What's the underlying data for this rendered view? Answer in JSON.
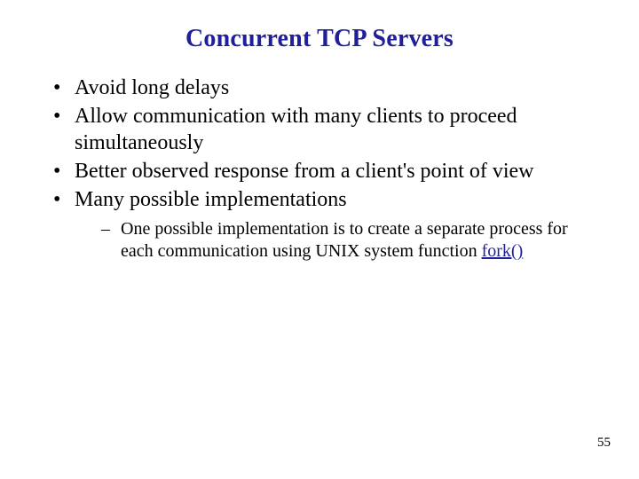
{
  "title": "Concurrent TCP Servers",
  "bullets": [
    "Avoid long delays",
    "Allow communication with many clients to proceed simultaneously",
    "Better observed response from a client's point of view",
    "Many possible implementations"
  ],
  "sub_bullet_prefix": "One possible implementation is to create a separate process for each communication using UNIX system function ",
  "sub_bullet_link": "fork()",
  "page_number": "55"
}
